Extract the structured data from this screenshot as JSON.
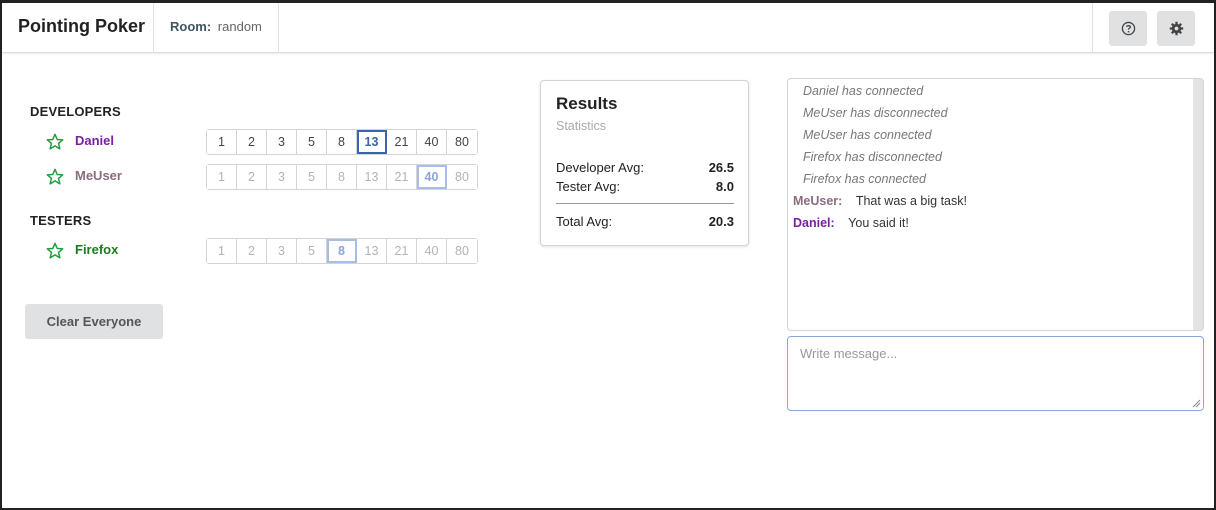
{
  "header": {
    "title": "Pointing Poker",
    "room_label": "Room:",
    "room_name": "random",
    "help_icon": "question-circle-icon",
    "settings_icon": "gear-icon"
  },
  "groups": {
    "developers": {
      "title": "DEVELOPERS",
      "players": [
        {
          "name": "Daniel",
          "name_color": "#7b1fa2",
          "icon": "star-outline-icon",
          "cards": [
            "1",
            "2",
            "3",
            "5",
            "8",
            "13",
            "21",
            "40",
            "80"
          ],
          "selected": "13",
          "active": true
        },
        {
          "name": "MeUser",
          "name_color": "#8a6d7e",
          "icon": "star-outline-icon",
          "cards": [
            "1",
            "2",
            "3",
            "5",
            "8",
            "13",
            "21",
            "40",
            "80"
          ],
          "selected": "40",
          "active": false
        }
      ]
    },
    "testers": {
      "title": "TESTERS",
      "players": [
        {
          "name": "Firefox",
          "name_color": "#1f7a1f",
          "icon": "star-outline-icon",
          "cards": [
            "1",
            "2",
            "3",
            "5",
            "8",
            "13",
            "21",
            "40",
            "80"
          ],
          "selected": "8",
          "active": false
        }
      ]
    }
  },
  "clear_button": "Clear Everyone",
  "results": {
    "title": "Results",
    "subtitle": "Statistics",
    "developer_label": "Developer Avg:",
    "developer_value": "26.5",
    "tester_label": "Tester Avg:",
    "tester_value": "8.0",
    "total_label": "Total Avg:",
    "total_value": "20.3"
  },
  "chat": {
    "system_messages": [
      "Daniel has connected",
      "MeUser has disconnected",
      "MeUser has connected",
      "Firefox has disconnected",
      "Firefox has connected"
    ],
    "user_messages": [
      {
        "author": "MeUser:",
        "text": "That was a big task!",
        "color": "#8a6d7e"
      },
      {
        "author": "Daniel:",
        "text": "You said it!",
        "color": "#7b1fa2"
      }
    ],
    "placeholder": "Write message..."
  },
  "colors": {
    "star": "#1e9e3a",
    "selected_card": "#3a63b0",
    "selected_card_dim": "#a9bde3"
  }
}
